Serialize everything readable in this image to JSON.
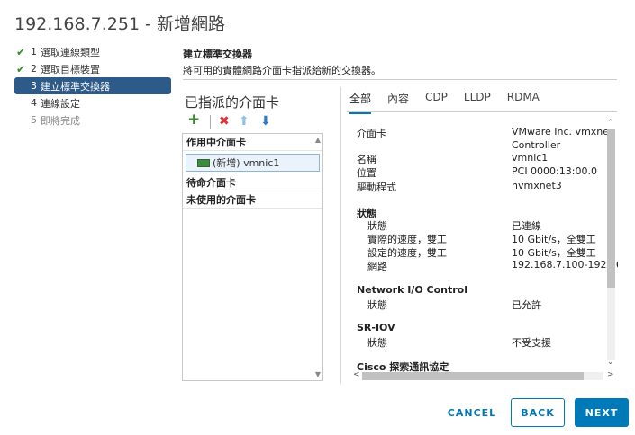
{
  "window": {
    "title": "192.168.7.251 - 新增網路"
  },
  "steps": [
    {
      "num": "1",
      "label": "選取連線類型",
      "state": "done"
    },
    {
      "num": "2",
      "label": "選取目標裝置",
      "state": "done"
    },
    {
      "num": "3",
      "label": "建立標準交換器",
      "state": "active"
    },
    {
      "num": "4",
      "label": "連線設定",
      "state": "pending"
    },
    {
      "num": "5",
      "label": "即將完成",
      "state": "disabled"
    }
  ],
  "header": {
    "title": "建立標準交換器",
    "subtitle": "將可用的實體網路介面卡指派給新的交換器。"
  },
  "assigned": {
    "title": "已指派的介面卡",
    "toolbar": {
      "add_icon": "+",
      "remove_icon": "✖",
      "up_icon": "⬆",
      "down_icon": "⬇"
    },
    "groups": {
      "active": "作用中介面卡",
      "standby": "待命介面卡",
      "unused": "未使用的介面卡"
    },
    "nic_label": "(新增) vmnic1"
  },
  "tabs": [
    "全部",
    "內容",
    "CDP",
    "LLDP",
    "RDMA"
  ],
  "details": {
    "adapter_label": "介面卡",
    "adapter_value_1": "VMware Inc. vmxne",
    "adapter_value_2": "Controller",
    "name_label": "名稱",
    "name_value": "vmnic1",
    "location_label": "位置",
    "location_value": "PCI 0000:13:00.0",
    "driver_label": "驅動程式",
    "driver_value": "nvmxnet3",
    "status_section": "狀態",
    "status_label": "狀態",
    "status_value": "已連線",
    "actual_speed_label": "實際的速度，雙工",
    "actual_speed_value": "10 Gbit/s，全雙工",
    "config_speed_label": "設定的速度，雙工",
    "config_speed_value": "10 Gbit/s，全雙工",
    "network_label": "網路",
    "network_value": "192.168.7.100-192.16",
    "nioc_section": "Network I/O Control",
    "nioc_label": "狀態",
    "nioc_value": "已允許",
    "sriov_section": "SR-IOV",
    "sriov_label": "狀態",
    "sriov_value": "不受支援",
    "cisco_section": "Cisco 探索通訊協定"
  },
  "buttons": {
    "cancel": "CANCEL",
    "back": "BACK",
    "next": "NEXT"
  },
  "colors": {
    "accent": "#0079b8",
    "active_step": "#2d5a88",
    "done_check": "#3a8a2f"
  }
}
